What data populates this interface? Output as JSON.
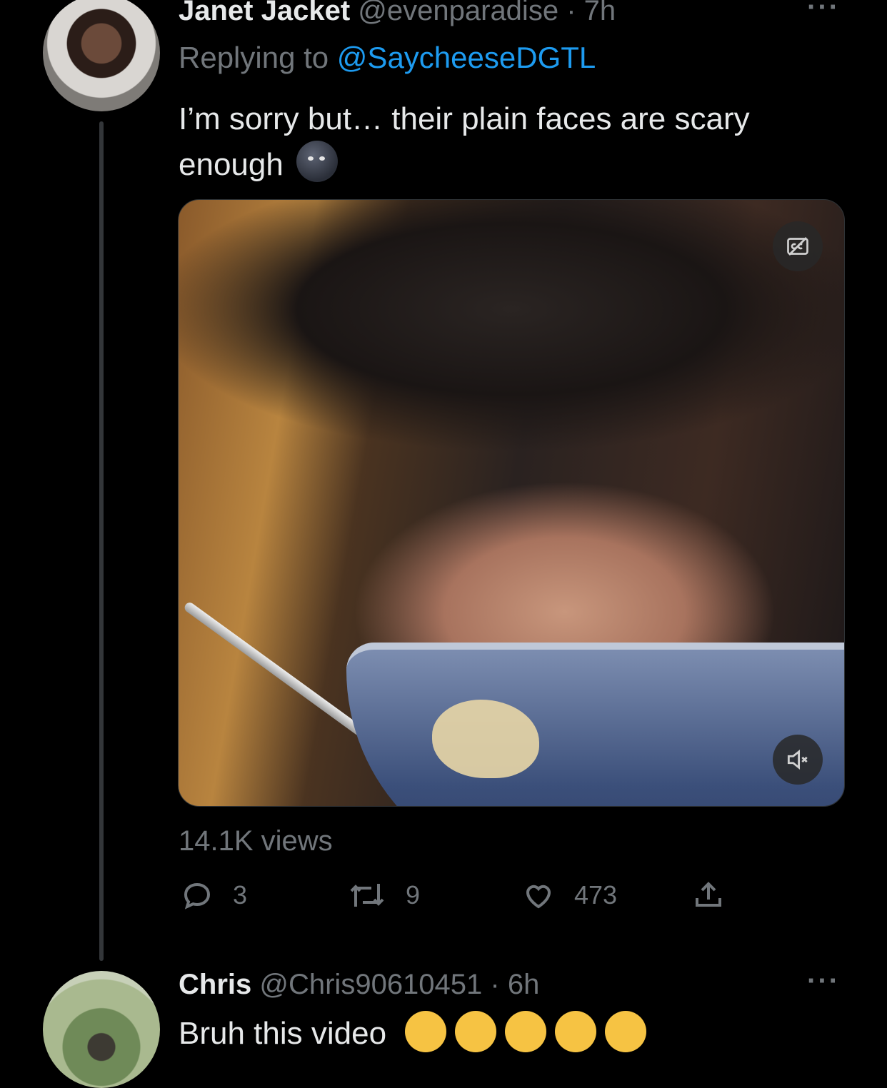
{
  "tweet1": {
    "display_name": "Janet Jacket",
    "handle": "@evenparadise",
    "time": "· 7h",
    "more": "···",
    "replying_prefix": "Replying to",
    "replying_to": "@SaycheeseDGTL",
    "text": "I’m sorry but… their plain faces are scary enough",
    "emoji": "new-moon-face",
    "views": "14.1K views",
    "reply_count": "3",
    "retweet_count": "9",
    "like_count": "473"
  },
  "tweet2": {
    "display_name": "Chris",
    "handle": "@Chris90610451",
    "time": "· 6h",
    "more": "···",
    "text": "Bruh this video",
    "emoji": "tears-of-joy x5"
  },
  "colors": {
    "background": "#000000",
    "text": "#e7e9ea",
    "secondary": "#71767b",
    "link": "#1d9bf0",
    "thread_line": "#333639"
  }
}
